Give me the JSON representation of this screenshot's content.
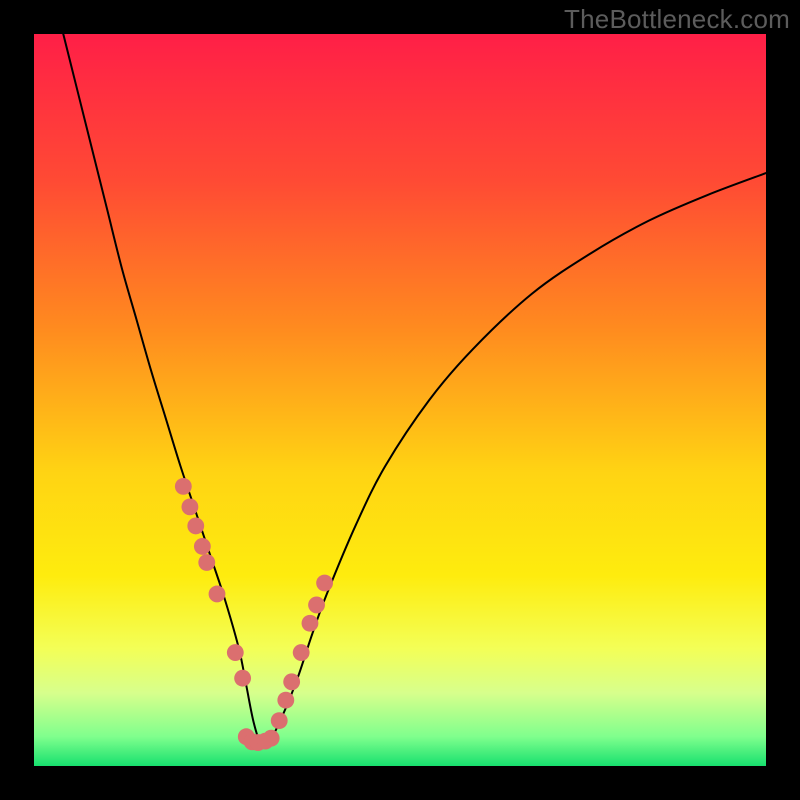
{
  "watermark": "TheBottleneck.com",
  "chart_data": {
    "type": "line",
    "title": "",
    "xlabel": "",
    "ylabel": "",
    "xlim": [
      0,
      100
    ],
    "ylim": [
      0,
      100
    ],
    "grid": false,
    "background_gradient": {
      "stops": [
        {
          "offset": 0,
          "color": "#ff1f47"
        },
        {
          "offset": 20,
          "color": "#ff4a34"
        },
        {
          "offset": 40,
          "color": "#ff8a1f"
        },
        {
          "offset": 60,
          "color": "#ffd413"
        },
        {
          "offset": 74,
          "color": "#feec0e"
        },
        {
          "offset": 84,
          "color": "#f3ff57"
        },
        {
          "offset": 90,
          "color": "#d7ff8c"
        },
        {
          "offset": 96,
          "color": "#7fff8d"
        },
        {
          "offset": 100,
          "color": "#17e06e"
        }
      ]
    },
    "series": [
      {
        "name": "curve",
        "color": "#000000",
        "x": [
          4,
          6,
          8,
          10,
          12,
          14,
          16,
          18,
          20,
          22,
          24,
          26,
          28,
          29,
          30,
          31,
          32,
          34,
          36,
          38,
          40,
          44,
          48,
          54,
          60,
          68,
          76,
          84,
          92,
          100
        ],
        "y": [
          100,
          92,
          84,
          76,
          68,
          61,
          54,
          47.5,
          41,
          35,
          29,
          23,
          16,
          11,
          6,
          3,
          3,
          7,
          12,
          18,
          23.5,
          33,
          41,
          50,
          57,
          64.5,
          70,
          74.5,
          78,
          81
        ]
      }
    ],
    "points": {
      "name": "markers",
      "color": "#db6f6f",
      "radius_pct": 1.15,
      "x": [
        20.4,
        21.3,
        22.1,
        23.0,
        23.6,
        25.0,
        27.5,
        28.5,
        29.0,
        29.8,
        30.6,
        31.6,
        32.4,
        33.5,
        34.4,
        35.2,
        36.5,
        37.7,
        38.6,
        39.7
      ],
      "y": [
        38.2,
        35.4,
        32.8,
        30.0,
        27.8,
        23.5,
        15.5,
        12.0,
        4.0,
        3.3,
        3.2,
        3.4,
        3.8,
        6.2,
        9.0,
        11.5,
        15.5,
        19.5,
        22.0,
        25.0
      ]
    }
  }
}
